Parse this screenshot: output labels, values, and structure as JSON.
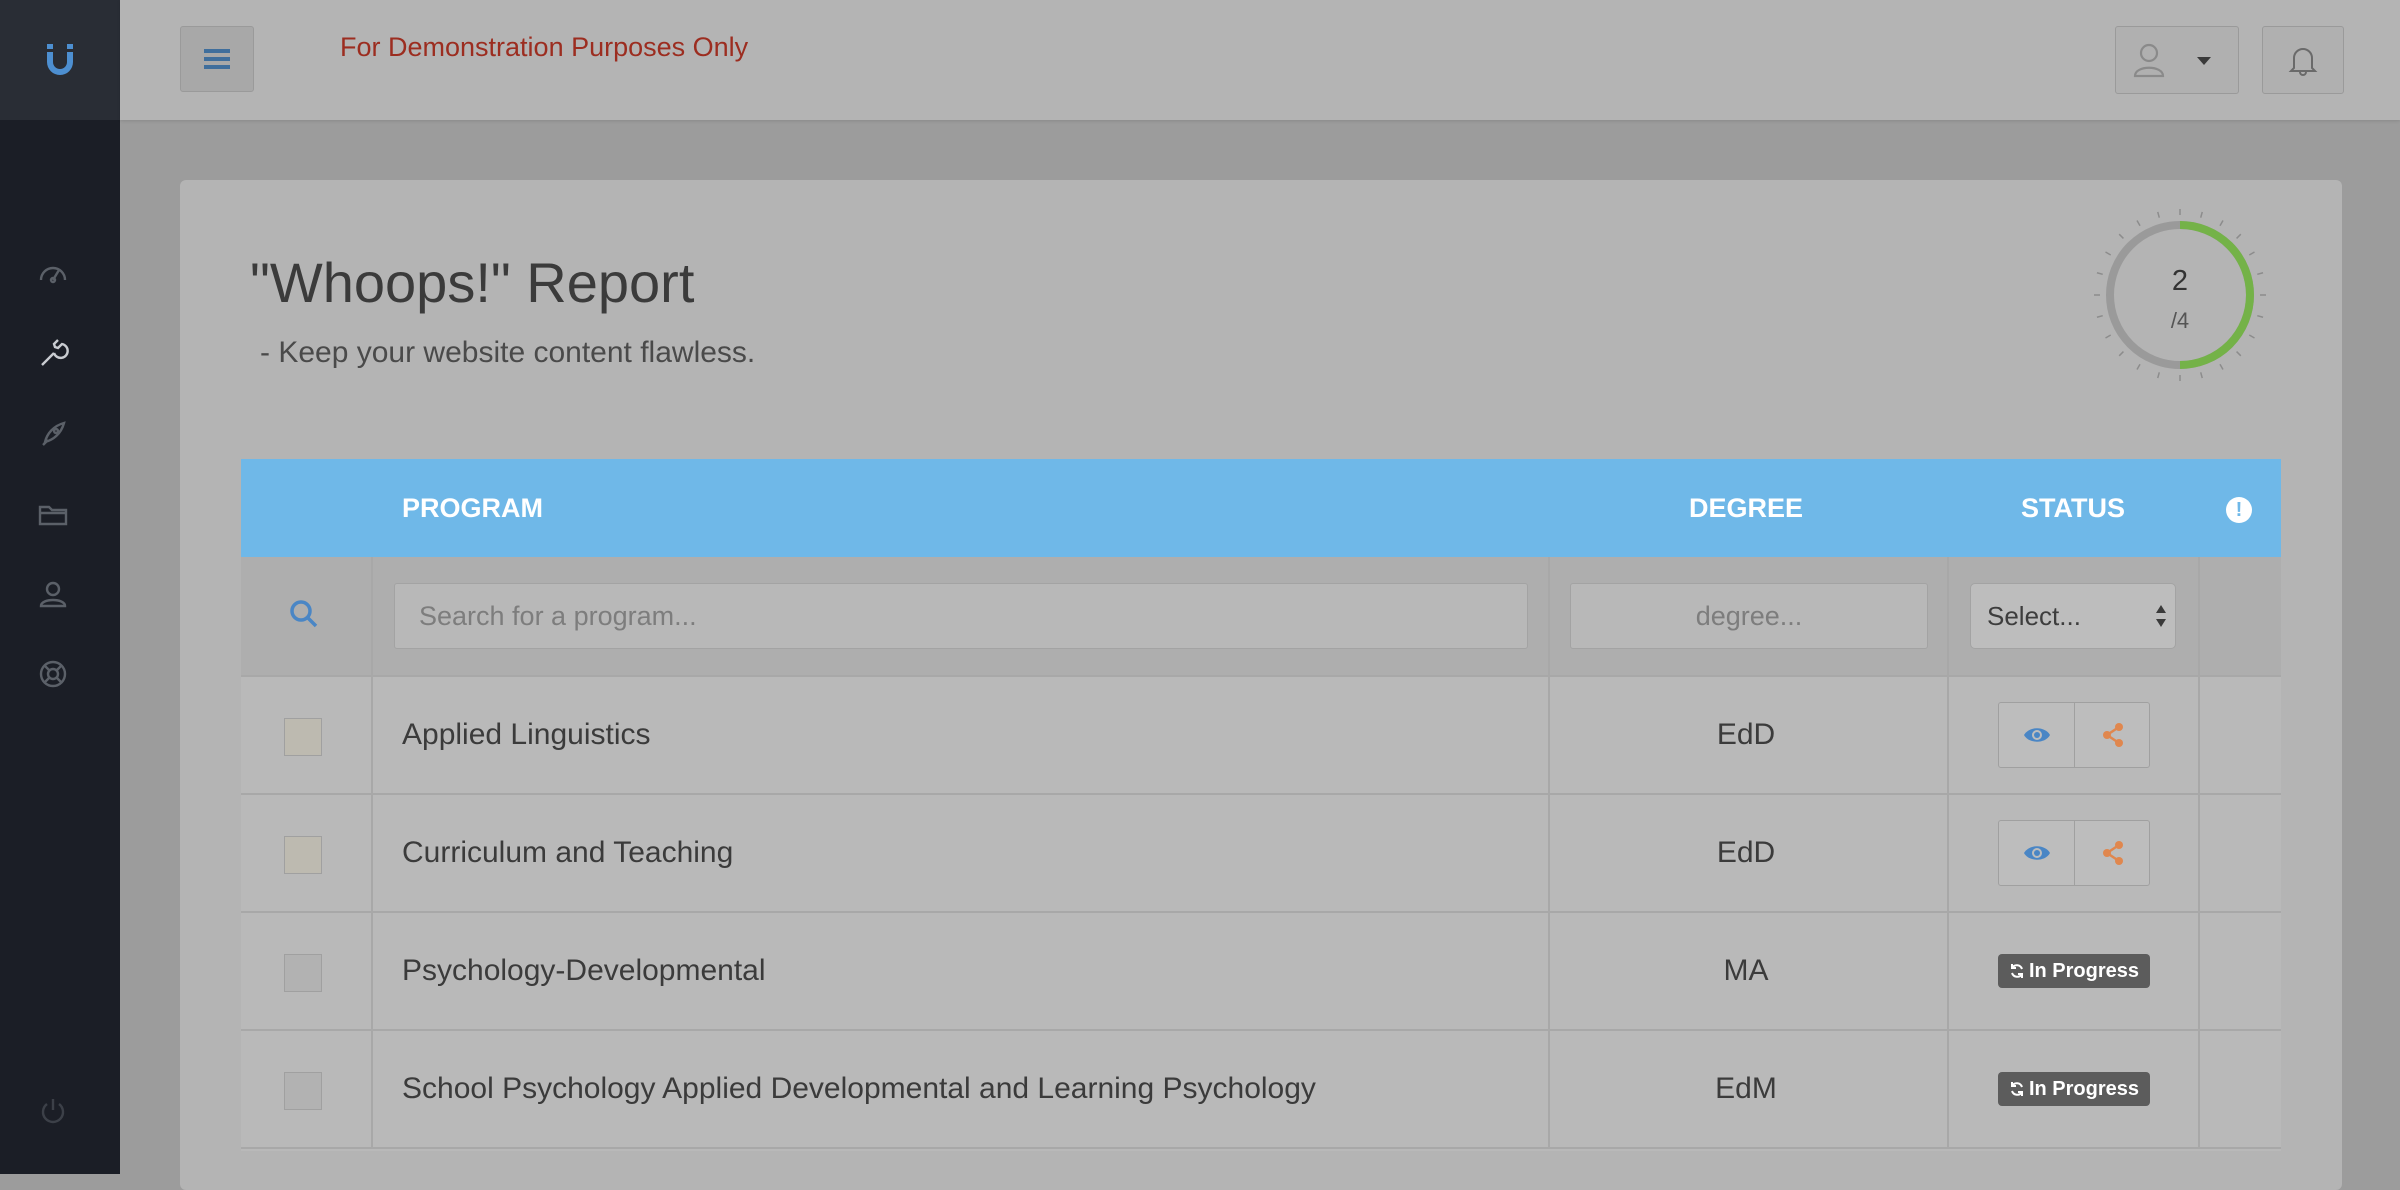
{
  "colors": {
    "sidebar_bg": "#1b1e26",
    "header_blue": "#6fb8e8",
    "gauge_progress": "#74b248",
    "demo_text": "#9c2d20",
    "view_icon": "#4a86c5",
    "share_icon": "#e0874e",
    "badge_bg": "#5c5c5c"
  },
  "sidebar": {
    "logo": "U",
    "items": [
      {
        "icon": "dashboard-gauge-icon"
      },
      {
        "icon": "wrench-icon"
      },
      {
        "icon": "rocket-icon"
      },
      {
        "icon": "folder-icon"
      },
      {
        "icon": "user-icon"
      },
      {
        "icon": "lifebuoy-icon"
      }
    ],
    "footer_icon": "power-icon"
  },
  "topbar": {
    "menu_icon": "hamburger-icon",
    "demo_notice": "For Demonstration Purposes Only",
    "user_icon": "user-icon",
    "dropdown_icon": "caret-down-icon",
    "bell_icon": "bell-icon"
  },
  "report": {
    "title": "\"Whoops!\" Report",
    "subtitle": "- Keep your website content flawless.",
    "progress": {
      "value": "2",
      "total": "/4",
      "fraction": 0.5
    }
  },
  "table": {
    "columns": {
      "program": "PROGRAM",
      "degree": "DEGREE",
      "status": "STATUS"
    },
    "filters": {
      "program_placeholder": "Search for a program...",
      "degree_placeholder": "degree...",
      "status_select": "Select..."
    },
    "rows": [
      {
        "program": "Applied Linguistics",
        "degree": "EdD",
        "status_type": "actions",
        "checkbox_color": "#bdbab0"
      },
      {
        "program": "Curriculum and Teaching",
        "degree": "EdD",
        "status_type": "actions",
        "checkbox_color": "#bdbab0"
      },
      {
        "program": "Psychology-Developmental",
        "degree": "MA",
        "status_type": "badge",
        "status_label": "In Progress",
        "checkbox_color": "#b2b2b2"
      },
      {
        "program": "School Psychology Applied Developmental and Learning Psychology",
        "degree": "EdM",
        "status_type": "badge",
        "status_label": "In Progress",
        "checkbox_color": "#b2b2b2"
      }
    ]
  }
}
